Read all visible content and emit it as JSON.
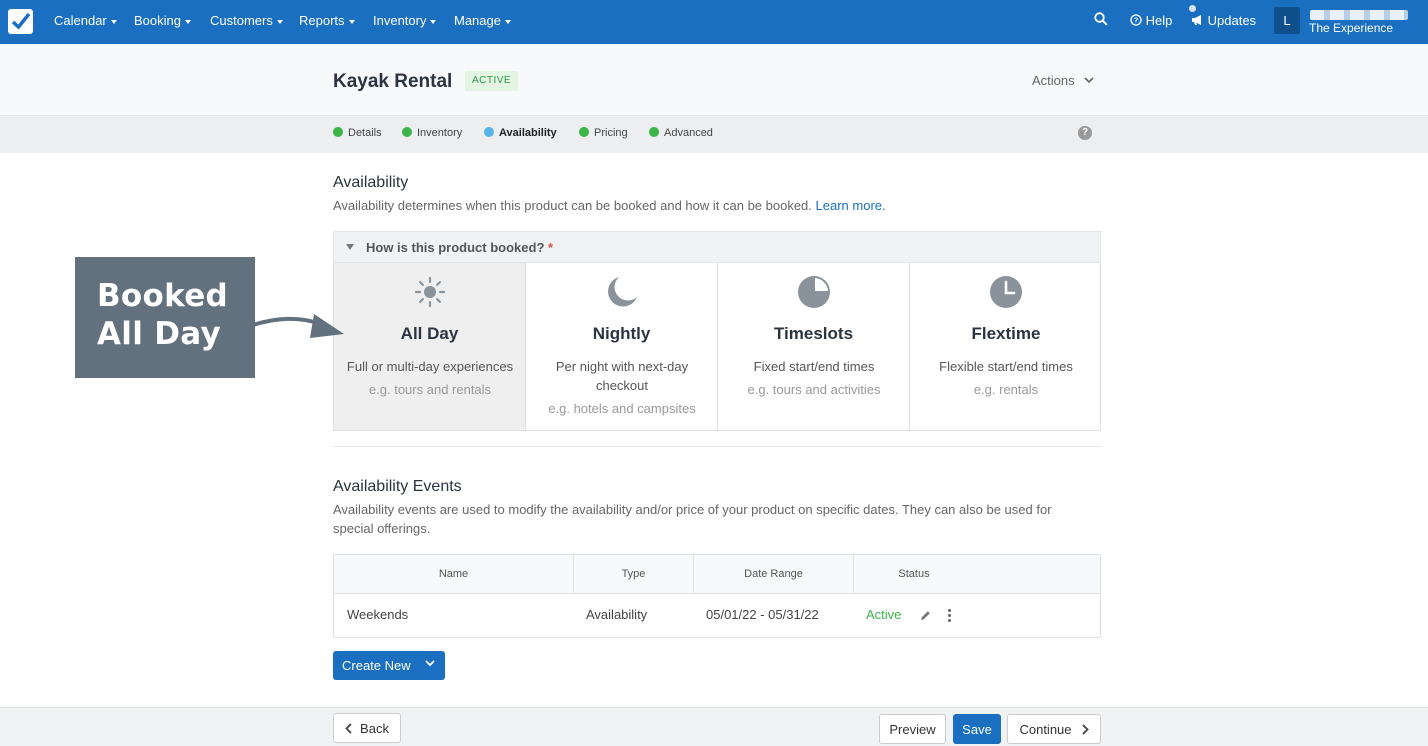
{
  "nav": {
    "items": [
      "Calendar",
      "Booking",
      "Customers",
      "Reports",
      "Inventory",
      "Manage"
    ],
    "help": "Help",
    "updates": "Updates",
    "avatar_initial": "L",
    "company": "The Experience"
  },
  "header": {
    "title": "Kayak Rental",
    "status": "ACTIVE",
    "actions": "Actions"
  },
  "steps": [
    "Details",
    "Inventory",
    "Availability",
    "Pricing",
    "Advanced"
  ],
  "steps_current": "Availability",
  "availability": {
    "title": "Availability",
    "desc": "Availability determines when this product can be booked and how it can be booked.",
    "learn_more": "Learn more.",
    "question": "How is this product booked?",
    "required_mark": "*",
    "options": [
      {
        "title": "All Day",
        "desc": "Full or multi-day experiences",
        "example": "e.g. tours and rentals",
        "icon": "sun-icon",
        "selected": true
      },
      {
        "title": "Nightly",
        "desc": "Per night with next-day checkout",
        "example": "e.g. hotels and campsites",
        "icon": "moon-icon",
        "selected": false
      },
      {
        "title": "Timeslots",
        "desc": "Fixed start/end times",
        "example": "e.g. tours and activities",
        "icon": "pie-clock-icon",
        "selected": false
      },
      {
        "title": "Flextime",
        "desc": "Flexible start/end times",
        "example": "e.g. rentals",
        "icon": "clock-icon",
        "selected": false
      }
    ]
  },
  "events": {
    "title": "Availability Events",
    "desc": "Availability events are used to modify the availability and/or price of your product on specific dates. They can also be used for special offerings.",
    "columns": [
      "Name",
      "Type",
      "Date Range",
      "Status"
    ],
    "rows": [
      {
        "name": "Weekends",
        "type": "Availability",
        "date_range": "05/01/22 - 05/31/22",
        "status": "Active"
      }
    ],
    "create_new": "Create New"
  },
  "footer": {
    "back": "Back",
    "preview": "Preview",
    "save": "Save",
    "continue": "Continue"
  },
  "callout": {
    "line1": "Booked",
    "line2": "All Day"
  },
  "colors": {
    "primary": "#1a6fc0",
    "done_step": "#3bb44a",
    "current_step": "#56b4e9",
    "callout_bg": "#63707e"
  }
}
